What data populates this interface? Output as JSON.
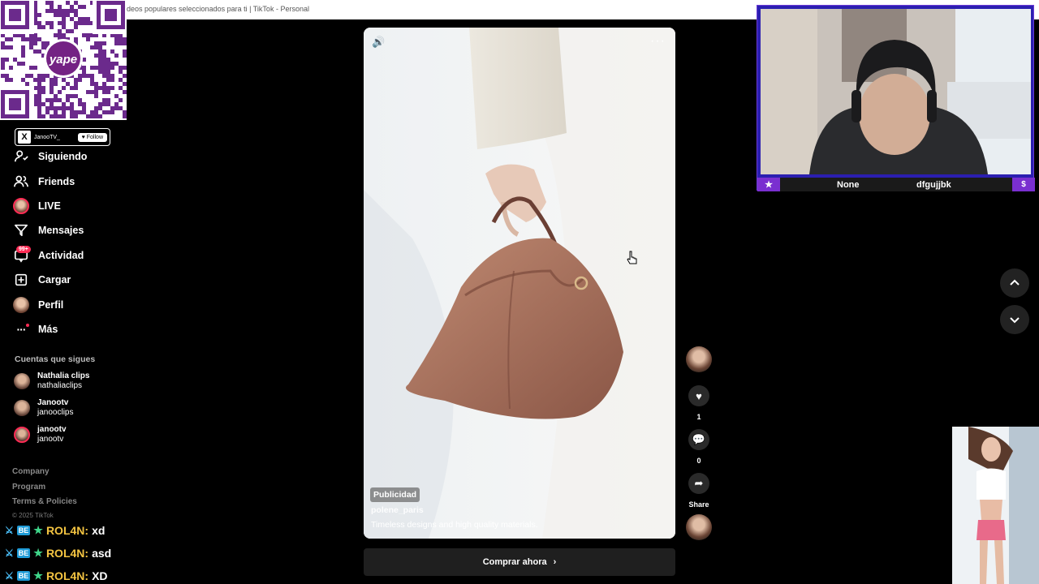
{
  "window": {
    "title": "deos populares seleccionados para ti | TikTok - Personal"
  },
  "qr": {
    "logo_text": "yape"
  },
  "x_badge": {
    "logo": "X",
    "name": "JanooTV_",
    "follow_label": "Follow"
  },
  "sidebar": {
    "items": [
      {
        "label": "Siguiendo",
        "icon": "following-icon"
      },
      {
        "label": "Friends",
        "icon": "friends-icon"
      },
      {
        "label": "LIVE",
        "icon": "live-avatar"
      },
      {
        "label": "Mensajes",
        "icon": "messages-icon"
      },
      {
        "label": "Actividad",
        "icon": "activity-icon",
        "badge": "99+"
      },
      {
        "label": "Cargar",
        "icon": "upload-icon"
      },
      {
        "label": "Perfil",
        "icon": "profile-avatar"
      },
      {
        "label": "Más",
        "icon": "more-icon"
      }
    ],
    "following_heading": "Cuentas que sigues",
    "following": [
      {
        "name": "Nathalia clips",
        "handle": "nathaliaclips",
        "live": false
      },
      {
        "name": "Janootv",
        "handle": "janooclips",
        "live": false
      },
      {
        "name": "janootv",
        "handle": "janootv",
        "live": true
      }
    ],
    "footer": [
      "Company",
      "Program",
      "Terms & Policies"
    ],
    "copyright": "© 2025 TikTok"
  },
  "chat": [
    {
      "badge": "BE",
      "user": "ROL4N:",
      "message": "xd"
    },
    {
      "badge": "BE",
      "user": "ROL4N:",
      "message": "asd"
    },
    {
      "badge": "BE",
      "user": "ROL4N:",
      "message": "XD"
    }
  ],
  "video": {
    "ad_tag": "Publicidad",
    "username": "polene_paris",
    "description": "Timeless designs and high quality materials.",
    "cta": "Comprar ahora"
  },
  "actions": {
    "likes": "1",
    "comments": "0",
    "share_label": "Share"
  },
  "webcam": {
    "name_left": "None",
    "name_right": "dfgujjbk"
  },
  "colors": {
    "accent": "#fe2c55",
    "stream_purple": "#7a2fd0",
    "chat_user": "#f5c542"
  }
}
